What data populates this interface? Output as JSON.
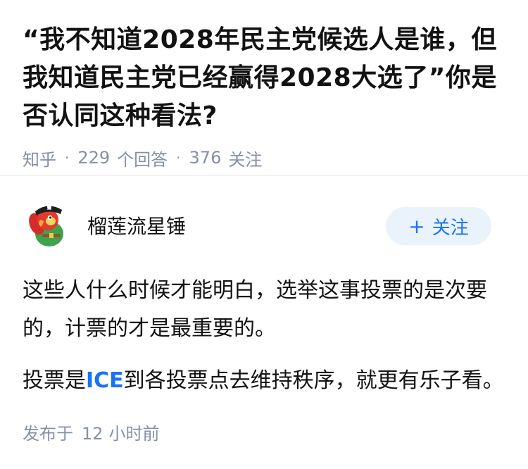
{
  "question": {
    "title": "“我不知道2028年民主党候选人是谁，但我知道民主党已经赢得2028大选了”你是否认同这种看法?",
    "platform": "知乎",
    "answer_count": "229",
    "answer_label": "个回答",
    "follow_count": "376",
    "follow_label": "关注"
  },
  "answer": {
    "author_name": "榴莲流星锤",
    "follow_button": "关注",
    "follow_icon": "plus-icon",
    "avatar_icon": "pirate-parrot-avatar",
    "paragraph1": "这些人什么时候才能明白，选举这事投票的是次要的，计票的才是最重要的。",
    "paragraph2_before": "投票是",
    "paragraph2_highlight": "ICE",
    "paragraph2_after": "到各投票点去维持秩序，就更有乐子看。",
    "time_prefix": "发布于",
    "time_value": "12",
    "time_unit": "小时前"
  },
  "colors": {
    "text": "#121212",
    "meta": "#8590a6",
    "accent": "#1772f6",
    "button_bg": "#eaf2fc"
  }
}
